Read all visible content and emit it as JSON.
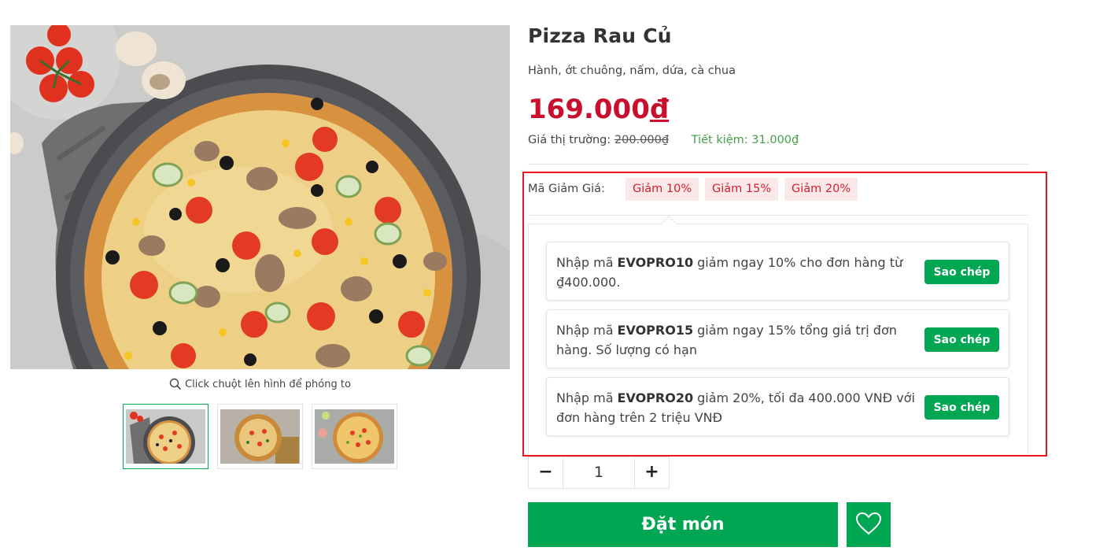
{
  "product": {
    "title": "Pizza Rau Củ",
    "description": "Hành, ớt chuông, nấm, dứa, cà chua",
    "price": "169.000",
    "currency": "đ",
    "market_label": "Giá thị trường:",
    "market_price": "200.000₫",
    "savings": "Tiết kiệm: 31.000₫"
  },
  "gallery": {
    "zoom_hint": "Click chuột lên hình để phóng to",
    "thumbnail_count": 3,
    "active_thumbnail": 1
  },
  "coupons": {
    "label": "Mã Giảm Giá:",
    "chips": [
      "Giảm 10%",
      "Giảm 15%",
      "Giảm 20%"
    ],
    "items": [
      {
        "prefix": "Nhập mã",
        "code": "EVOPRO10",
        "text": "giảm ngay 10% cho đơn hàng từ ₫400.000."
      },
      {
        "prefix": "Nhập mã",
        "code": "EVOPRO15",
        "text": "giảm ngay 15% tổng giá trị đơn hàng. Số lượng có hạn"
      },
      {
        "prefix": "Nhập mã",
        "code": "EVOPRO20",
        "text": "giảm 20%, tối đa 400.000 VNĐ với đơn hàng trên 2 triệu VNĐ"
      }
    ],
    "copy_label": "Sao chép"
  },
  "quantity": {
    "minus": "−",
    "value": "1",
    "plus": "+"
  },
  "actions": {
    "order_label": "Đặt món"
  },
  "colors": {
    "brand_green": "#00a651",
    "price_red": "#c8102e",
    "chip_bg": "#fbe9ea",
    "chip_text": "#d31f2d",
    "highlight_outline": "#e8171f",
    "savings_green": "#43a047"
  },
  "icons": {
    "zoom": "magnifier-icon",
    "wishlist": "heart-icon"
  }
}
